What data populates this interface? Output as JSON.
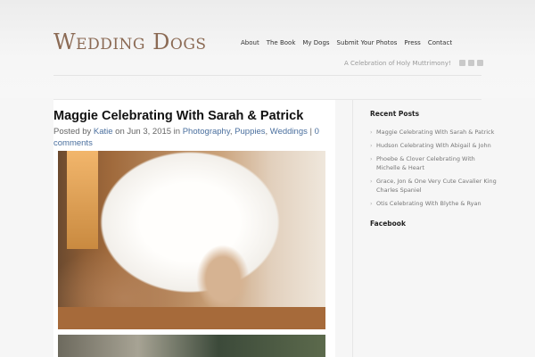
{
  "site": {
    "logo": "Wedding Dogs",
    "tagline": "A Celebration of Holy Muttrimony!"
  },
  "nav": [
    "About",
    "The Book",
    "My Dogs",
    "Submit Your Photos",
    "Press",
    "Contact"
  ],
  "social_icons": [
    "twitter-icon",
    "instagram-icon",
    "facebook-icon"
  ],
  "post": {
    "title": "Maggie Celebrating With Sarah & Patrick",
    "meta_prefix": "Posted by ",
    "author": "Katie",
    "date_text": " on Jun 3, 2015 in ",
    "categories": [
      "Photography",
      "Puppies",
      "Weddings"
    ],
    "comments": "0 comments"
  },
  "sidebar": {
    "recent_title": "Recent Posts",
    "recent_posts": [
      "Maggie Celebrating With Sarah & Patrick",
      "Hudson Celebrating With Abigail & John",
      "Phoebe & Clover Celebrating With Michelle & Heart",
      "Grace, Jon & One Very Cute Cavalier King Charles Spaniel",
      "Otis Celebrating With Blythe & Ryan"
    ],
    "facebook_title": "Facebook"
  }
}
